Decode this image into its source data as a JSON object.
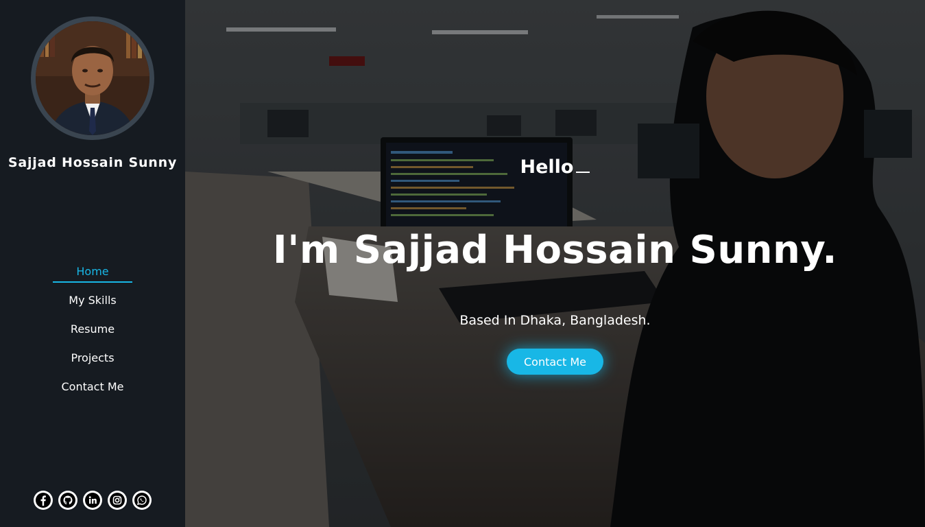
{
  "sidebar": {
    "name": "Sajjad Hossain Sunny",
    "nav": [
      {
        "label": "Home",
        "active": true
      },
      {
        "label": "My Skills"
      },
      {
        "label": "Resume"
      },
      {
        "label": "Projects"
      },
      {
        "label": "Contact Me"
      }
    ],
    "socials": [
      "facebook-icon",
      "github-icon",
      "linkedin-icon",
      "instagram-icon",
      "whatsapp-icon"
    ]
  },
  "hero": {
    "greeting": "Hello",
    "headline": "I'm Sajjad Hossain Sunny.",
    "location": "Based In Dhaka, Bangladesh.",
    "cta_label": "Contact Me"
  },
  "colors": {
    "accent": "#18b7e6",
    "sidebar_bg": "#161b21"
  }
}
